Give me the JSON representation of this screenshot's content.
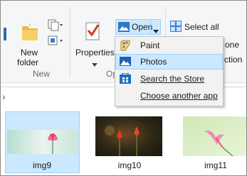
{
  "ribbon": {
    "new_folder_label_1": "New",
    "new_folder_label_2": "folder",
    "new_group_label": "New",
    "properties_label": "Properties",
    "open_group_label": "Op",
    "open_label": "Open",
    "select_all_label": "Select all",
    "hidden_partial_1": "one",
    "hidden_partial_2": "ction"
  },
  "open_menu": {
    "items": [
      {
        "label": "Paint",
        "icon": "paint-icon"
      },
      {
        "label": "Photos",
        "icon": "photos-icon"
      },
      {
        "label": "Search the Store",
        "icon": "store-icon"
      },
      {
        "label": "Choose another app",
        "icon": ""
      }
    ],
    "highlighted_index": 1
  },
  "files": [
    {
      "name": "img9",
      "selected": true
    },
    {
      "name": "img10",
      "selected": false
    },
    {
      "name": "img11",
      "selected": false
    }
  ],
  "colors": {
    "selection": "#cce8ff",
    "selection_border": "#99d1ff",
    "ribbon_bg": "#f5f6f7",
    "menu_bg": "#f2f2f2"
  }
}
